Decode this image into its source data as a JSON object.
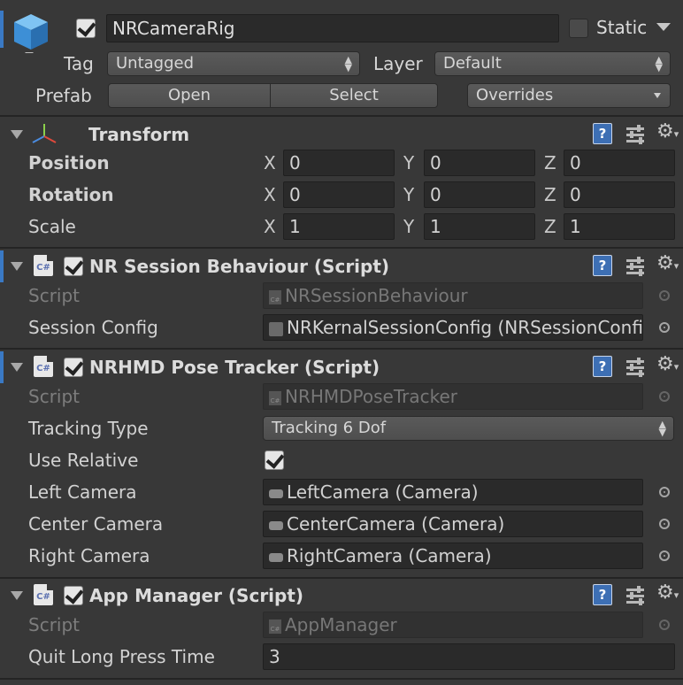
{
  "header": {
    "object_name": "NRCameraRig",
    "active_checked": true,
    "static_label": "Static",
    "static_checked": false,
    "tag_label": "Tag",
    "tag_value": "Untagged",
    "layer_label": "Layer",
    "layer_value": "Default",
    "prefab_label": "Prefab",
    "open_label": "Open",
    "select_label": "Select",
    "overrides_label": "Overrides"
  },
  "transform": {
    "title": "Transform",
    "rows": [
      {
        "label": "Position",
        "x": "0",
        "y": "0",
        "z": "0"
      },
      {
        "label": "Rotation",
        "x": "0",
        "y": "0",
        "z": "0"
      },
      {
        "label": "Scale",
        "x": "1",
        "y": "1",
        "z": "1"
      }
    ],
    "axis_x": "X",
    "axis_y": "Y",
    "axis_z": "Z"
  },
  "session": {
    "title": "NR Session Behaviour (Script)",
    "script_label": "Script",
    "script_value": "NRSessionBehaviour",
    "config_label": "Session Config",
    "config_value": "NRKernalSessionConfig (NRSessionConfig)"
  },
  "pose": {
    "title": "NRHMD Pose Tracker (Script)",
    "script_label": "Script",
    "script_value": "NRHMDPoseTracker",
    "tracking_label": "Tracking Type",
    "tracking_value": "Tracking 6 Dof",
    "relative_label": "Use Relative",
    "relative_checked": true,
    "left_label": "Left Camera",
    "left_value": "LeftCamera (Camera)",
    "center_label": "Center Camera",
    "center_value": "CenterCamera (Camera)",
    "right_label": "Right Camera",
    "right_value": "RightCamera (Camera)"
  },
  "app": {
    "title": "App Manager (Script)",
    "script_label": "Script",
    "script_value": "AppManager",
    "quit_label": "Quit Long Press Time",
    "quit_value": "3"
  },
  "icons": {
    "cube": "gameobject-cube-icon",
    "transform": "transform-gizmo-icon",
    "script": "csharp-script-icon",
    "help": "help-book-icon",
    "presets": "presets-sliders-icon",
    "gear": "settings-gear-icon",
    "target": "object-picker-icon",
    "camera": "camera-icon",
    "scriptable": "scriptable-object-icon"
  },
  "colors": {
    "background": "#383838",
    "field": "#2a2a2a",
    "accent": "#3a79c4"
  }
}
